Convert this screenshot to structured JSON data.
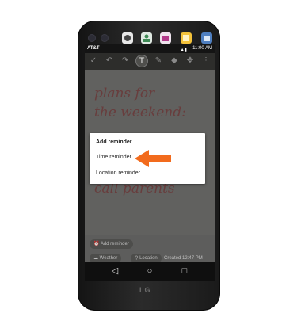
{
  "status_bar": {
    "carrier": "AT&T",
    "time": "11:00 AM"
  },
  "note": {
    "lines": [
      "plans for",
      "the weekend:",
      "call parents"
    ]
  },
  "dialog": {
    "title": "Add reminder",
    "options": [
      "Time reminder",
      "Location reminder"
    ]
  },
  "bottom_bar": {
    "add_reminder": "Add reminder",
    "weather": "Weather",
    "location": "Location",
    "created": "Created 12:47 PM"
  },
  "device": {
    "brand": "LG"
  },
  "colors": {
    "arrow": "#f26b1d",
    "ink": "#7a3434"
  }
}
